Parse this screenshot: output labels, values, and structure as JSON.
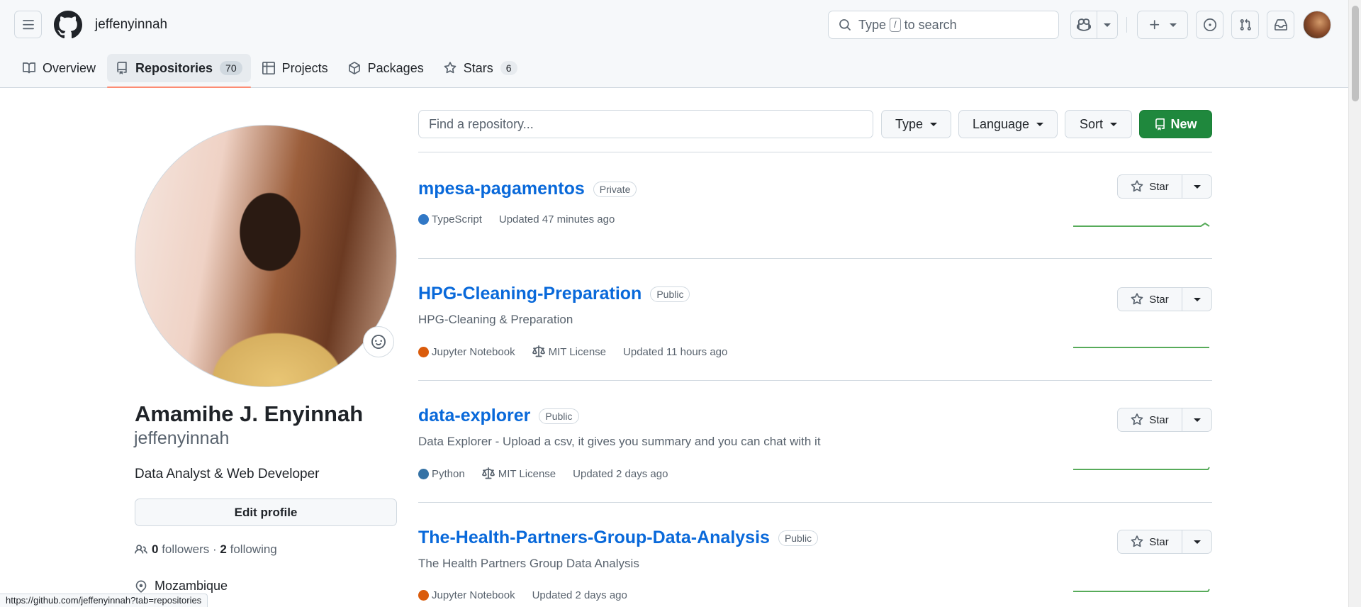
{
  "header": {
    "username": "jeffenyinnah",
    "search_prefix": "Type",
    "search_key": "/",
    "search_suffix": "to search",
    "status_url": "https://github.com/jeffenyinnah?tab=repositories"
  },
  "nav": {
    "tabs": [
      {
        "label": "Overview",
        "icon": "book-icon"
      },
      {
        "label": "Repositories",
        "icon": "repo-icon",
        "count": "70",
        "active": true
      },
      {
        "label": "Projects",
        "icon": "table-icon"
      },
      {
        "label": "Packages",
        "icon": "package-icon"
      },
      {
        "label": "Stars",
        "icon": "star-icon",
        "count": "6"
      }
    ]
  },
  "profile": {
    "full_name": "Amamihe J. Enyinnah",
    "login": "jeffenyinnah",
    "bio": "Data Analyst & Web Developer",
    "edit_label": "Edit profile",
    "followers_count": "0",
    "followers_label": "followers",
    "following_count": "2",
    "following_label": "following",
    "location": "Mozambique"
  },
  "filters": {
    "search_placeholder": "Find a repository...",
    "type_label": "Type",
    "language_label": "Language",
    "sort_label": "Sort",
    "new_label": "New"
  },
  "repos": [
    {
      "name": "mpesa-pagamentos",
      "visibility": "Private",
      "description": "",
      "language": "TypeScript",
      "language_color": "#3178c6",
      "license": "",
      "updated": "Updated 47 minutes ago",
      "star_label": "Star"
    },
    {
      "name": "HPG-Cleaning-Preparation",
      "visibility": "Public",
      "description": "HPG-Cleaning & Preparation",
      "language": "Jupyter Notebook",
      "language_color": "#da5b0b",
      "license": "MIT License",
      "updated": "Updated 11 hours ago",
      "star_label": "Star"
    },
    {
      "name": "data-explorer",
      "visibility": "Public",
      "description": "Data Explorer - Upload a csv, it gives you summary and you can chat with it",
      "language": "Python",
      "language_color": "#3572A5",
      "license": "MIT License",
      "updated": "Updated 2 days ago",
      "star_label": "Star"
    },
    {
      "name": "The-Health-Partners-Group-Data-Analysis",
      "visibility": "Public",
      "description": "The Health Partners Group Data Analysis",
      "language": "Jupyter Notebook",
      "language_color": "#da5b0b",
      "license": "",
      "updated": "Updated 2 days ago",
      "star_label": "Star"
    }
  ],
  "colors": {
    "accent_link": "#0969da",
    "primary_button": "#1f883d",
    "active_tab_underline": "#fd8c73",
    "sparkline": "#57ab5a"
  }
}
